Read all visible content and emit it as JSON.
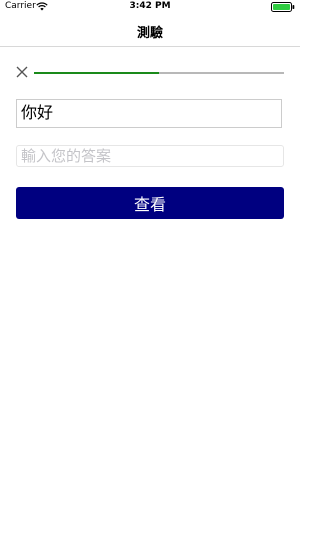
{
  "status_bar": {
    "carrier": "Carrier",
    "time": "3:42 PM",
    "wifi_icon": "wifi-icon",
    "battery_icon": "battery-icon"
  },
  "nav": {
    "title": "測驗"
  },
  "quiz": {
    "close_icon": "close-icon",
    "progress_fraction": 0.5,
    "progress_color": "#1a8a1a",
    "track_color": "#b8b8b8",
    "question_text": "你好",
    "answer_value": "",
    "answer_placeholder": "輸入您的答案",
    "check_label": "查看",
    "check_button_color": "#000080"
  }
}
